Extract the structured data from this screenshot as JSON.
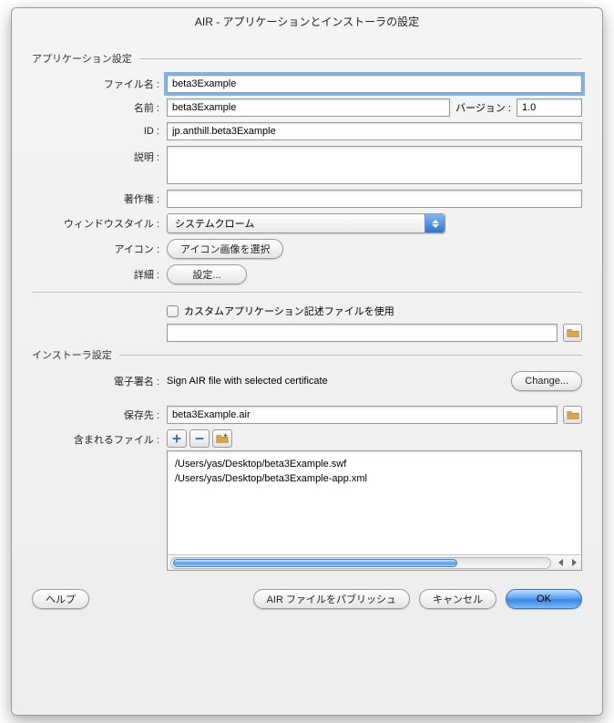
{
  "title": "AIR - アプリケーションとインストーラの設定",
  "sections": {
    "app": "アプリケーション設定",
    "installer": "インストーラ設定"
  },
  "labels": {
    "filename": "ファイル名 :",
    "name": "名前 :",
    "version": "バージョン :",
    "id": "ID :",
    "description": "説明 :",
    "copyright": "著作権 :",
    "windowstyle": "ウィンドウスタイル :",
    "icon": "アイコン :",
    "detail": "詳細 :",
    "custom_desc": "カスタムアプリケーション記述ファイルを使用",
    "signature": "電子署名 :",
    "destination": "保存先 :",
    "included_files": "含まれるファイル :"
  },
  "values": {
    "filename": "beta3Example",
    "name": "beta3Example",
    "version": "1.0",
    "id": "jp.anthill.beta3Example",
    "description": "",
    "copyright": "",
    "windowstyle": "システムクローム",
    "custom_desc_path": "",
    "signature_text": "Sign AIR file with selected certificate",
    "destination": "beta3Example.air"
  },
  "buttons": {
    "select_icon": "アイコン画像を選択",
    "settings": "設定...",
    "change": "Change...",
    "help": "ヘルプ",
    "publish": "AIR ファイルをパブリッシュ",
    "cancel": "キャンセル",
    "ok": "OK"
  },
  "included_files": [
    "/Users/yas/Desktop/beta3Example.swf",
    "/Users/yas/Desktop/beta3Example-app.xml"
  ]
}
